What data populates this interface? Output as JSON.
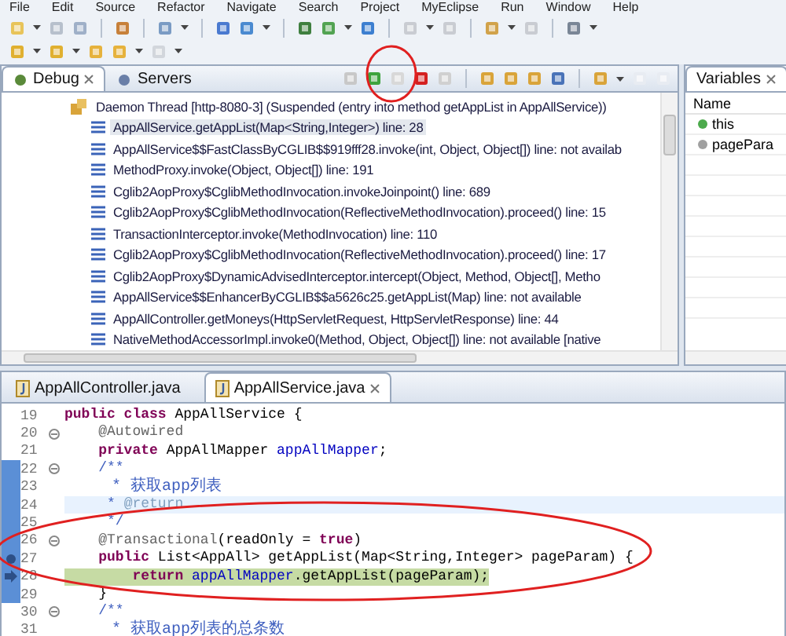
{
  "menu": [
    "File",
    "Edit",
    "Source",
    "Refactor",
    "Navigate",
    "Search",
    "Project",
    "MyEclipse",
    "Run",
    "Window",
    "Help"
  ],
  "debug_view": {
    "tabs": [
      {
        "label": "Debug",
        "selected": true
      },
      {
        "label": "Servers",
        "selected": false
      }
    ],
    "thread": "Daemon Thread [http-8080-3] (Suspended (entry into method getAppList in AppAllService))",
    "frames": [
      {
        "text": "AppAllService.getAppList(Map<String,Integer>) line: 28",
        "selected": true
      },
      {
        "text": "AppAllService$$FastClassByCGLIB$$919fff28.invoke(int, Object, Object[]) line: not availab",
        "selected": false
      },
      {
        "text": "MethodProxy.invoke(Object, Object[]) line: 191",
        "selected": false
      },
      {
        "text": "Cglib2AopProxy$CglibMethodInvocation.invokeJoinpoint() line: 689",
        "selected": false
      },
      {
        "text": "Cglib2AopProxy$CglibMethodInvocation(ReflectiveMethodInvocation).proceed() line: 15",
        "selected": false
      },
      {
        "text": "TransactionInterceptor.invoke(MethodInvocation) line: 110",
        "selected": false
      },
      {
        "text": "Cglib2AopProxy$CglibMethodInvocation(ReflectiveMethodInvocation).proceed() line: 17",
        "selected": false
      },
      {
        "text": "Cglib2AopProxy$DynamicAdvisedInterceptor.intercept(Object, Method, Object[], Metho",
        "selected": false
      },
      {
        "text": "AppAllService$$EnhancerByCGLIB$$a5626c25.getAppList(Map) line: not available",
        "selected": false
      },
      {
        "text": "AppAllController.getMoneys(HttpServletRequest, HttpServletResponse) line: 44",
        "selected": false
      },
      {
        "text": "NativeMethodAccessorImpl.invoke0(Method, Object, Object[]) line: not available [native",
        "selected": false
      }
    ]
  },
  "variables_view": {
    "title": "Variables",
    "column": "Name",
    "rows": [
      "this",
      "pagePara"
    ]
  },
  "editor": {
    "tabs": [
      {
        "label": "AppAllController.java",
        "selected": false
      },
      {
        "label": "AppAllService.java",
        "selected": true
      }
    ],
    "lines": [
      {
        "number": "19",
        "fold": false,
        "current_line": false,
        "debug_line": false,
        "breakpoint": false,
        "instruction_pointer": false,
        "tokens": [
          {
            "text": "public class ",
            "kind": "keyword"
          },
          {
            "text": "AppAllService {",
            "kind": "plain"
          }
        ]
      },
      {
        "number": "20",
        "fold": true,
        "current_line": false,
        "debug_line": false,
        "breakpoint": false,
        "instruction_pointer": false,
        "tokens": [
          {
            "text": "    @Autowired",
            "kind": "annotation"
          }
        ]
      },
      {
        "number": "21",
        "fold": false,
        "current_line": false,
        "debug_line": false,
        "breakpoint": false,
        "instruction_pointer": false,
        "tokens": [
          {
            "text": "    private ",
            "kind": "keyword"
          },
          {
            "text": "AppAllMapper ",
            "kind": "plain"
          },
          {
            "text": "appAllMapper",
            "kind": "field"
          },
          {
            "text": ";",
            "kind": "plain"
          }
        ]
      },
      {
        "number": "22",
        "fold": true,
        "current_line": false,
        "debug_line": false,
        "breakpoint": false,
        "instruction_pointer": false,
        "tokens": [
          {
            "text": "    /**",
            "kind": "doc"
          }
        ]
      },
      {
        "number": "23",
        "fold": false,
        "current_line": false,
        "debug_line": false,
        "breakpoint": false,
        "instruction_pointer": false,
        "tokens": [
          {
            "text": "     * 获取app列表",
            "kind": "doc"
          }
        ]
      },
      {
        "number": "24",
        "fold": false,
        "current_line": true,
        "debug_line": false,
        "breakpoint": false,
        "instruction_pointer": false,
        "tokens": [
          {
            "text": "     * ",
            "kind": "doc"
          },
          {
            "text": "@return",
            "kind": "doctag"
          }
        ]
      },
      {
        "number": "25",
        "fold": false,
        "current_line": false,
        "debug_line": false,
        "breakpoint": false,
        "instruction_pointer": false,
        "tokens": [
          {
            "text": "     */",
            "kind": "doc"
          }
        ]
      },
      {
        "number": "26",
        "fold": true,
        "current_line": false,
        "debug_line": false,
        "breakpoint": false,
        "instruction_pointer": false,
        "tokens": [
          {
            "text": "    @Transactional",
            "kind": "annotation"
          },
          {
            "text": "(readOnly = ",
            "kind": "plain"
          },
          {
            "text": "true",
            "kind": "keyword"
          },
          {
            "text": ")",
            "kind": "plain"
          }
        ]
      },
      {
        "number": "27",
        "fold": false,
        "current_line": false,
        "debug_line": false,
        "breakpoint": true,
        "instruction_pointer": false,
        "tokens": [
          {
            "text": "    public ",
            "kind": "keyword"
          },
          {
            "text": "List<AppAll> getAppList(Map<String,Integer> pageParam) {",
            "kind": "plain"
          }
        ]
      },
      {
        "number": "28",
        "fold": false,
        "current_line": false,
        "debug_line": true,
        "breakpoint": false,
        "instruction_pointer": true,
        "tokens": [
          {
            "text": "        return ",
            "kind": "keyword"
          },
          {
            "text": "appAllMapper",
            "kind": "field"
          },
          {
            "text": ".getAppList(pageParam);",
            "kind": "plain"
          }
        ]
      },
      {
        "number": "29",
        "fold": false,
        "current_line": false,
        "debug_line": false,
        "breakpoint": false,
        "instruction_pointer": false,
        "tokens": [
          {
            "text": "    }",
            "kind": "plain"
          }
        ]
      },
      {
        "number": "30",
        "fold": true,
        "current_line": false,
        "debug_line": false,
        "breakpoint": false,
        "instruction_pointer": false,
        "tokens": [
          {
            "text": "    /**",
            "kind": "doc"
          }
        ]
      },
      {
        "number": "31",
        "fold": false,
        "current_line": false,
        "debug_line": false,
        "breakpoint": false,
        "instruction_pointer": false,
        "tokens": [
          {
            "text": "     * 获取app列表的总条数",
            "kind": "doc"
          }
        ]
      }
    ]
  }
}
